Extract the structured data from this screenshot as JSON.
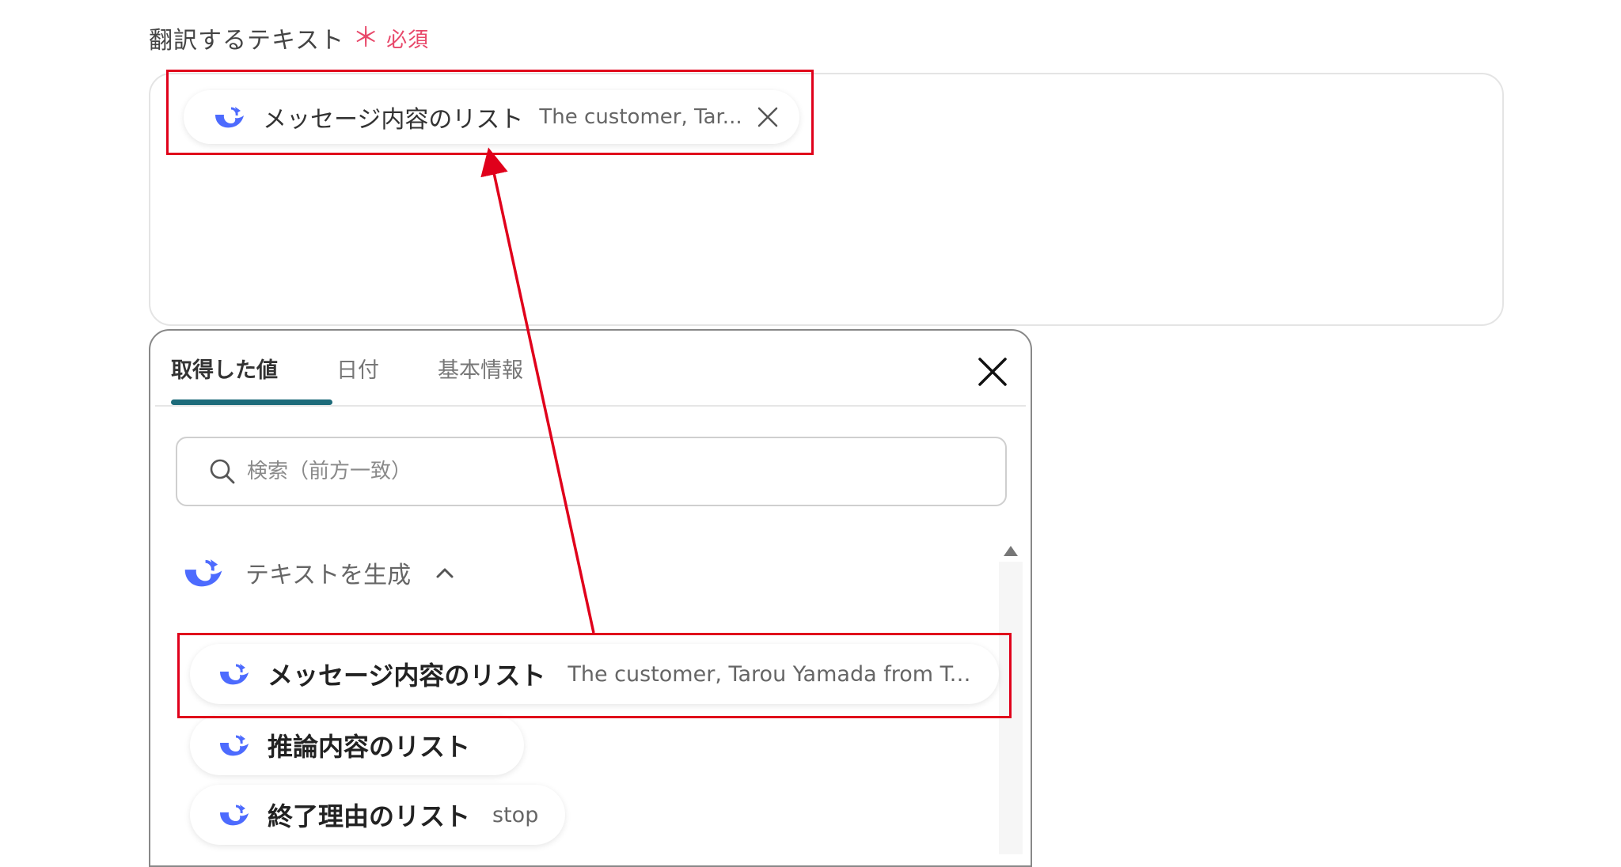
{
  "field": {
    "label": "翻訳するテキスト",
    "required_mark": "＊",
    "required_text": "必須"
  },
  "selected_chip": {
    "label": "メッセージ内容のリスト",
    "value": "The customer, Tar..."
  },
  "panel": {
    "tabs": [
      {
        "label": "取得した値",
        "active": true
      },
      {
        "label": "日付",
        "active": false
      },
      {
        "label": "基本情報",
        "active": false
      }
    ],
    "search_placeholder": "検索（前方一致）",
    "group": {
      "title": "テキストを生成",
      "items": [
        {
          "label": "メッセージ内容のリスト",
          "value": "The customer, Tarou Yamada from Te..."
        },
        {
          "label": "推論内容のリスト",
          "value": ""
        },
        {
          "label": "終了理由のリスト",
          "value": "stop"
        }
      ]
    }
  },
  "colors": {
    "accent": "#1d6b7a",
    "required": "#e8486a",
    "highlight": "#e0001b",
    "whale_icon": "#4d6bfe"
  }
}
